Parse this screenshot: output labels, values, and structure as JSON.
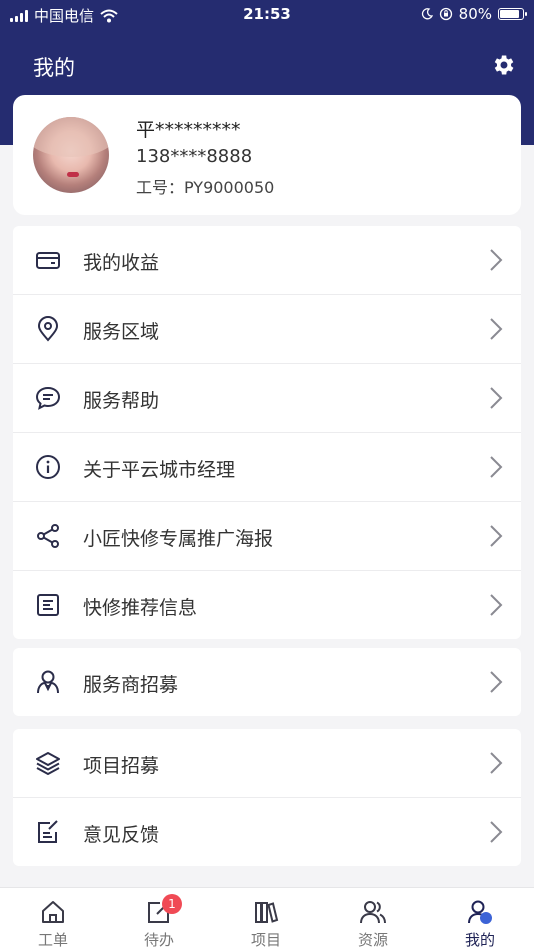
{
  "status_bar": {
    "carrier": "中国电信",
    "time": "21:53",
    "battery": "80%"
  },
  "header": {
    "title": "我的"
  },
  "profile": {
    "name": "平*********",
    "phone": "138****8888",
    "employee_id": "工号：PY9000050"
  },
  "menu_group_1": [
    {
      "label": "我的收益",
      "icon": "wallet-icon"
    },
    {
      "label": "服务区域",
      "icon": "location-pin-icon"
    },
    {
      "label": "服务帮助",
      "icon": "chat-bubble-icon"
    },
    {
      "label": "关于平云城市经理",
      "icon": "info-icon"
    },
    {
      "label": "小匠快修专属推广海报",
      "icon": "share-icon"
    },
    {
      "label": "快修推荐信息",
      "icon": "document-list-icon"
    }
  ],
  "menu_group_2": [
    {
      "label": "服务商招募",
      "icon": "person-tie-icon"
    }
  ],
  "menu_group_3": [
    {
      "label": "项目招募",
      "icon": "layers-icon"
    },
    {
      "label": "意见反馈",
      "icon": "edit-note-icon"
    }
  ],
  "tabbar": {
    "items": [
      {
        "label": "工单",
        "icon": "home-icon"
      },
      {
        "label": "待办",
        "icon": "todo-edit-icon",
        "badge": "1"
      },
      {
        "label": "项目",
        "icon": "books-icon"
      },
      {
        "label": "资源",
        "icon": "people-icon"
      },
      {
        "label": "我的",
        "icon": "user-icon",
        "active": true
      }
    ]
  },
  "colors": {
    "header_bg": "#252c70",
    "badge": "#f04a55",
    "active_tab": "#1f2356"
  }
}
